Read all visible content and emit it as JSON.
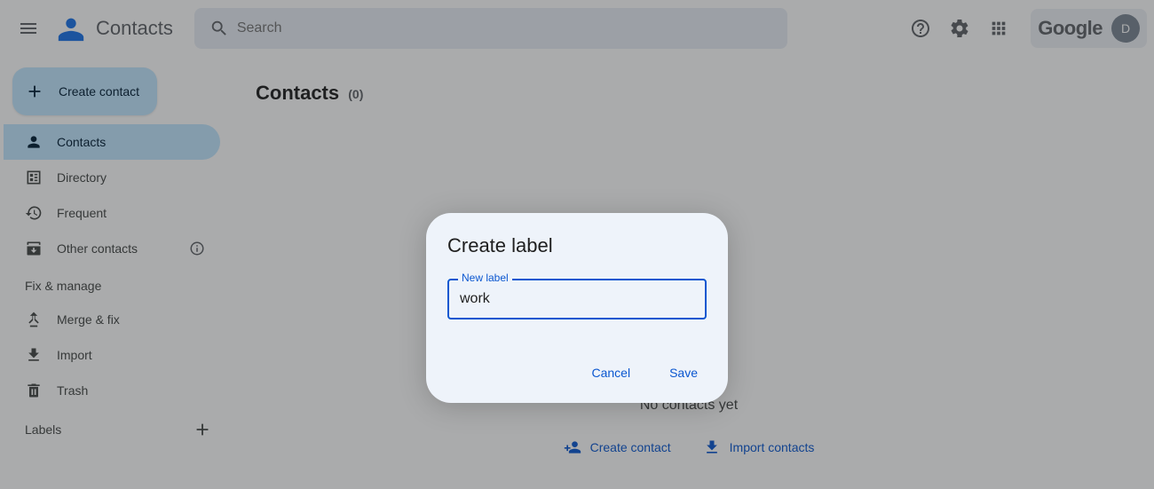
{
  "header": {
    "app_name": "Contacts",
    "search_placeholder": "Search",
    "google_brand": "Google",
    "avatar_initial": "D"
  },
  "sidebar": {
    "create_label": "Create contact",
    "items": [
      {
        "label": "Contacts"
      },
      {
        "label": "Directory"
      },
      {
        "label": "Frequent"
      },
      {
        "label": "Other contacts"
      }
    ],
    "fix_manage_title": "Fix & manage",
    "fix_items": [
      {
        "label": "Merge & fix"
      },
      {
        "label": "Import"
      },
      {
        "label": "Trash"
      }
    ],
    "labels_title": "Labels"
  },
  "main": {
    "title": "Contacts",
    "count_label": "(0)",
    "empty_text": "No contacts yet",
    "create_contact_label": "Create contact",
    "import_contacts_label": "Import contacts"
  },
  "dialog": {
    "title": "Create label",
    "field_label": "New label",
    "field_value": "work",
    "cancel_label": "Cancel",
    "save_label": "Save"
  }
}
